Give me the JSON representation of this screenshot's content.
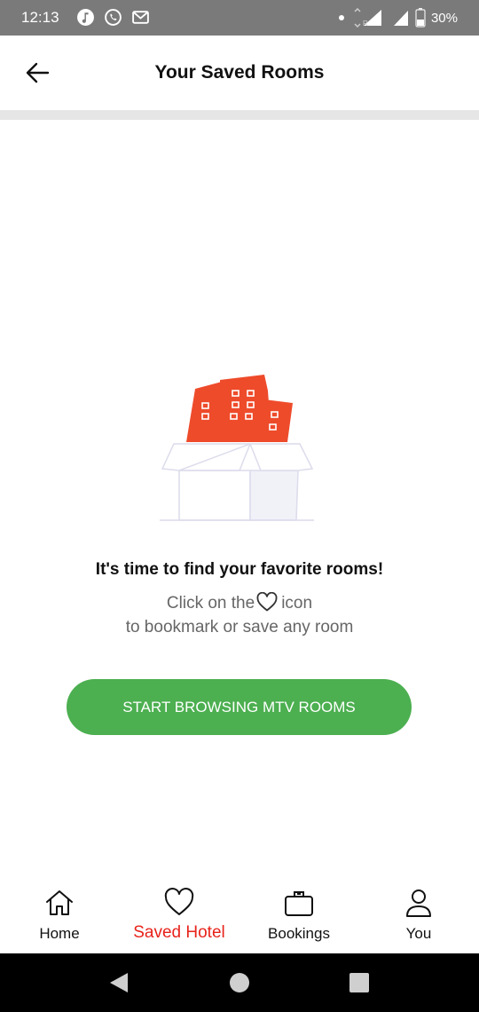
{
  "status_bar": {
    "time": "12:13",
    "battery": "30%",
    "icons": [
      "music-icon",
      "whatsapp-icon",
      "gmail-icon",
      "dot-icon",
      "signal-icon",
      "signal-icon",
      "battery-icon"
    ]
  },
  "header": {
    "title": "Your Saved Rooms",
    "back_icon": "arrow-left-icon"
  },
  "empty_state": {
    "title": "It's time to find your favorite rooms!",
    "line1_before": "Click on the",
    "line1_after": "icon",
    "line2": "to bookmark or save any room",
    "illustration": "buildings-in-box-illustration"
  },
  "cta": {
    "label": "START BROWSING MTV ROOMS"
  },
  "bottom_nav": {
    "items": [
      {
        "label": "Home",
        "icon": "home-icon",
        "active": false
      },
      {
        "label": "Saved Hotel",
        "icon": "heart-icon",
        "active": true
      },
      {
        "label": "Bookings",
        "icon": "briefcase-icon",
        "active": false
      },
      {
        "label": "You",
        "icon": "user-icon",
        "active": false
      }
    ]
  },
  "colors": {
    "accent_green": "#4caf50",
    "active_red": "#e8231b",
    "building_red": "#ee4b2b",
    "status_bar": "#7a7a7a"
  }
}
